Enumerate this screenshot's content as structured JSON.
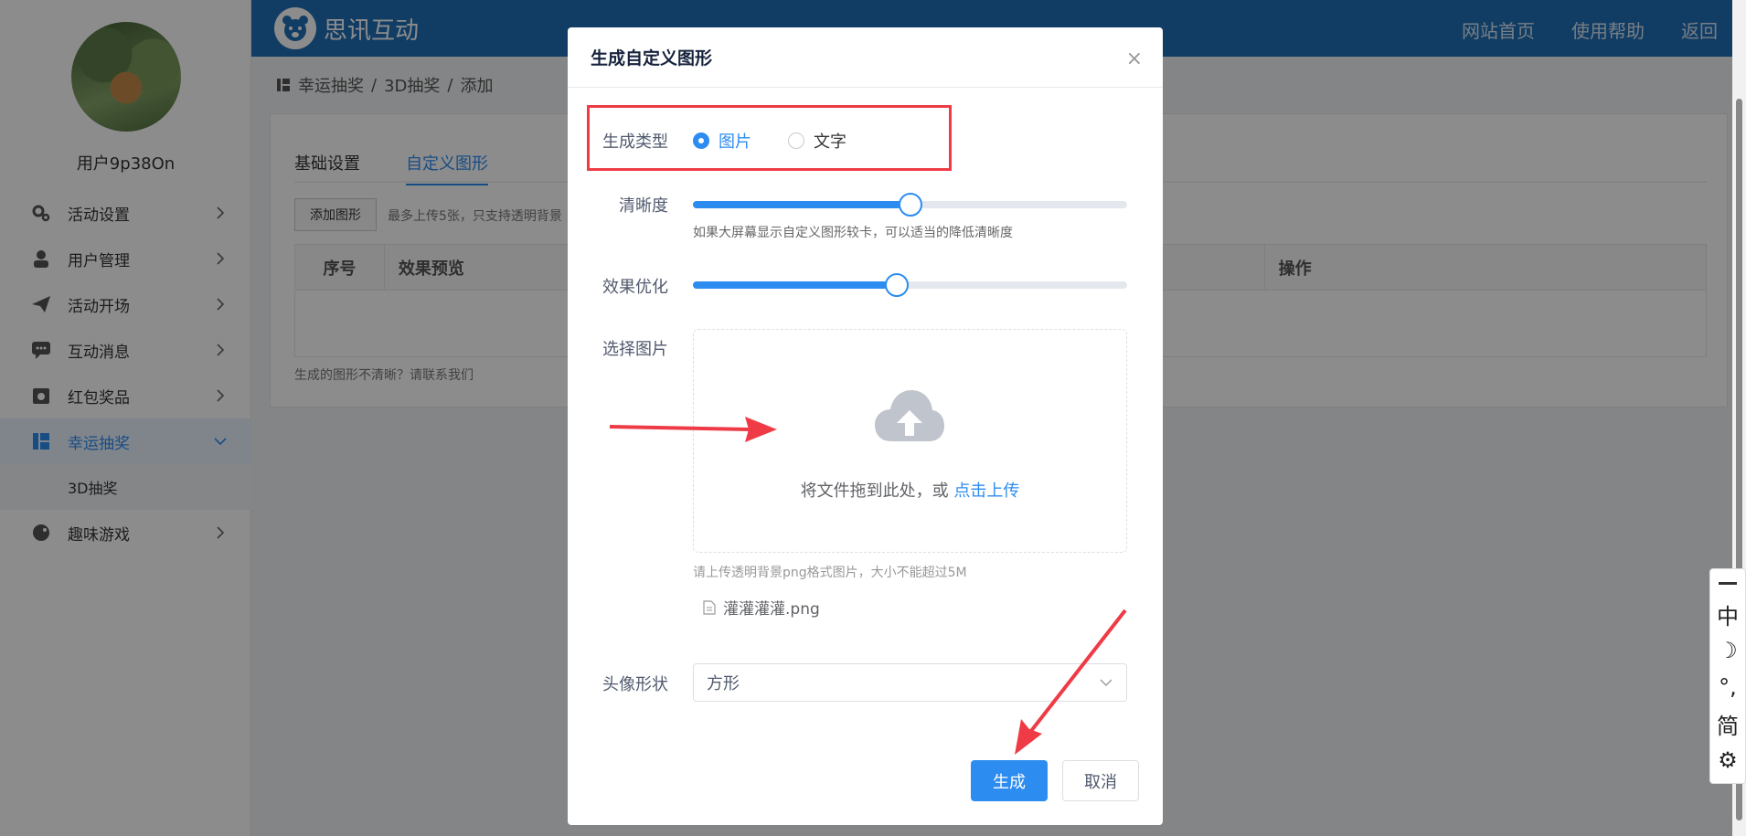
{
  "sidebar": {
    "username": "用户9p38On",
    "menu": [
      {
        "label": "活动设置",
        "icon": "gears-icon"
      },
      {
        "label": "用户管理",
        "icon": "user-icon"
      },
      {
        "label": "活动开场",
        "icon": "paper-plane-icon"
      },
      {
        "label": "互动消息",
        "icon": "chat-icon"
      },
      {
        "label": "红包奖品",
        "icon": "gift-icon"
      },
      {
        "label": "幸运抽奖",
        "icon": "lottery-icon",
        "active": true
      },
      {
        "label": "3D抽奖",
        "sub": true
      },
      {
        "label": "趣味游戏",
        "icon": "gamepad-icon"
      }
    ]
  },
  "topbar": {
    "brand": "思讯互动",
    "nav": [
      "网站首页",
      "使用帮助",
      "返回"
    ]
  },
  "breadcrumb": [
    "幸运抽奖",
    "3D抽奖",
    "添加"
  ],
  "content": {
    "tabs": [
      "基础设置",
      "自定义图形"
    ],
    "add_button": "添加图形",
    "hint": "最多上传5张，只支持透明背景",
    "columns": [
      "序号",
      "效果预览",
      "操作"
    ],
    "footnote": "生成的图形不清晰？请联系我们"
  },
  "modal": {
    "title": "生成自定义图形",
    "close": "×",
    "type_label": "生成类型",
    "type_options": [
      "图片",
      "文字"
    ],
    "type_selected": "图片",
    "clarity_label": "清晰度",
    "clarity_value": 0.5,
    "clarity_hint": "如果大屏幕显示自定义图形较卡，可以适当的降低清晰度",
    "optimize_label": "效果优化",
    "optimize_value": 0.47,
    "image_label": "选择图片",
    "upload_text": "将文件拖到此处，或 ",
    "upload_link": "点击上传",
    "upload_tip": "请上传透明背景png格式图片，大小不能超过5M",
    "file_name": "灌灌灌灌.png",
    "shape_label": "头像形状",
    "shape_value": "方形",
    "submit": "生成",
    "cancel": "取消"
  },
  "ime": [
    "中",
    "☽",
    "°,",
    "简",
    "⚙"
  ],
  "colors": {
    "primary": "#2d8cf0",
    "topbar": "#1f6fb6",
    "annotation": "#ef3b45"
  }
}
